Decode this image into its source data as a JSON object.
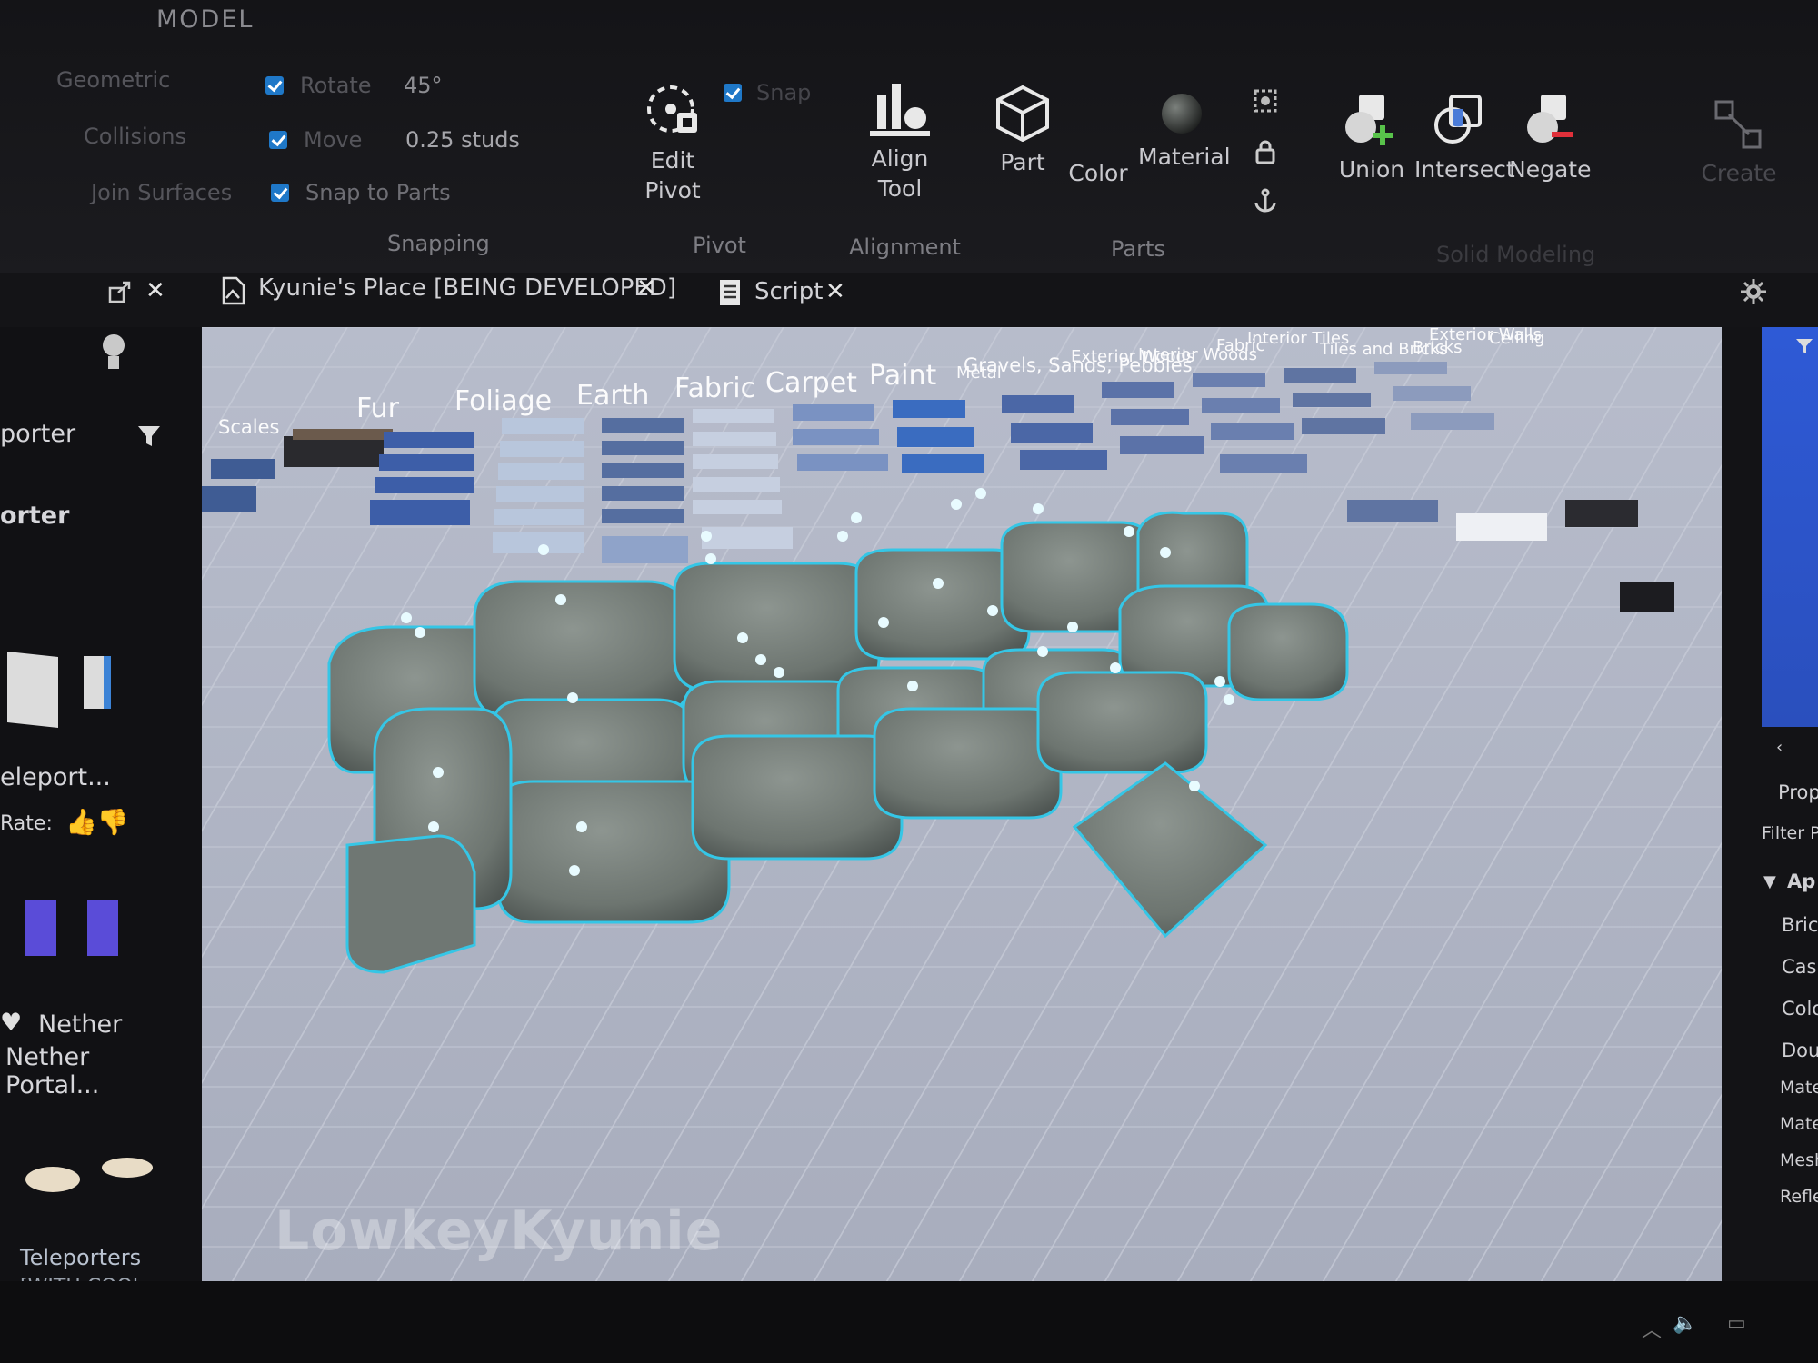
{
  "ribbon": {
    "active_tab": "MODEL",
    "geometric": "Geometric",
    "collisions": "Collisions",
    "join_surfaces": "Join Surfaces",
    "rotate_label": "Rotate",
    "rotate_value": "45°",
    "move_label": "Move",
    "move_value": "0.25 studs",
    "snap_to_parts": "Snap to Parts",
    "snap": "Snap",
    "groups": {
      "snapping": "Snapping",
      "pivot": "Pivot",
      "alignment": "Alignment",
      "parts": "Parts",
      "solid_modeling": "Solid Modeling"
    },
    "tools": {
      "edit_pivot": "Edit Pivot",
      "align_tool": "Align Tool",
      "part": "Part",
      "color": "Color",
      "material": "Material",
      "union": "Union",
      "intersect": "Intersect",
      "negate": "Negate",
      "create": "Create"
    }
  },
  "doc_tabs": [
    {
      "label": "Kyunie's Place [BEING DEVELOPED]"
    },
    {
      "label": "Script"
    }
  ],
  "viewport": {
    "categories": [
      "Scales",
      "Fur",
      "Foliage",
      "Earth",
      "Fabric",
      "Carpet",
      "Paint",
      "Metal",
      "Gravels, Sands, Pebbles",
      "Exterior Woods",
      "Interior Woods",
      "Fabric",
      "Interior Tiles",
      "Tiles and Bricks",
      "Bricks",
      "Exterior Walls",
      "Ceiling"
    ],
    "watermark": "LowkeyKyunie"
  },
  "left_panel": {
    "items": [
      "porter",
      "orter",
      "eleport...",
      "Rate:",
      "Nether Portal...",
      "Teleporters",
      "[WITH COOL"
    ]
  },
  "right_panel": {
    "items": [
      "Prop",
      "Filter P",
      "Ap",
      "Bric",
      "Cas",
      "Colo",
      "Dou",
      "Mate",
      "Mate",
      "Mesh",
      "Refle"
    ]
  },
  "colors": {
    "selection": "#35c6e6",
    "accent": "#1f78c8",
    "sofa": "#7d8581"
  }
}
